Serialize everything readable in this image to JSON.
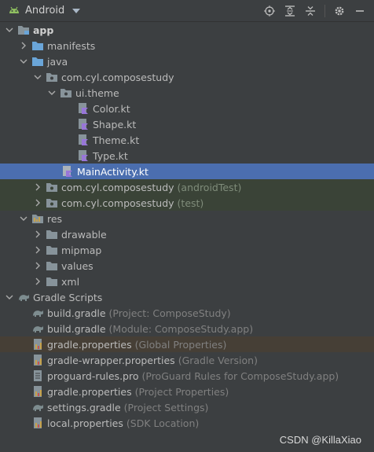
{
  "toolbar": {
    "view_name": "Android",
    "icons": [
      "android-icon",
      "locate-icon",
      "expand-all-icon",
      "collapse-all-icon",
      "settings-icon",
      "minimize-icon"
    ]
  },
  "tree": {
    "app": "app",
    "manifests": "manifests",
    "java": "java",
    "pkg_main": "com.cyl.composestudy",
    "ui_theme": "ui.theme",
    "color_kt": "Color.kt",
    "shape_kt": "Shape.kt",
    "theme_kt": "Theme.kt",
    "type_kt": "Type.kt",
    "main_activity": "MainActivity.kt",
    "pkg_android_test": "com.cyl.composestudy",
    "pkg_android_test_hint": "(androidTest)",
    "pkg_test": "com.cyl.composestudy",
    "pkg_test_hint": "(test)",
    "res": "res",
    "drawable": "drawable",
    "mipmap": "mipmap",
    "values": "values",
    "xml": "xml",
    "gradle_scripts": "Gradle Scripts",
    "build_gradle_project": "build.gradle",
    "build_gradle_project_hint": "(Project: ComposeStudy)",
    "build_gradle_module": "build.gradle",
    "build_gradle_module_hint": "(Module: ComposeStudy.app)",
    "gradle_props_global": "gradle.properties",
    "gradle_props_global_hint": "(Global Properties)",
    "gradle_wrapper": "gradle-wrapper.properties",
    "gradle_wrapper_hint": "(Gradle Version)",
    "proguard": "proguard-rules.pro",
    "proguard_hint": "(ProGuard Rules for ComposeStudy.app)",
    "gradle_props_project": "gradle.properties",
    "gradle_props_project_hint": "(Project Properties)",
    "settings_gradle": "settings.gradle",
    "settings_gradle_hint": "(Project Settings)",
    "local_props": "local.properties",
    "local_props_hint": "(SDK Location)"
  },
  "watermark": "CSDN @KillaXiao",
  "colors": {
    "background": "#3c3f41",
    "selection": "#4b6eaf",
    "test_highlight": "#3a4337",
    "global_highlight": "#463f36",
    "folder_blue": "#6aa5d8",
    "kotlin_purple": "#9876d9"
  }
}
